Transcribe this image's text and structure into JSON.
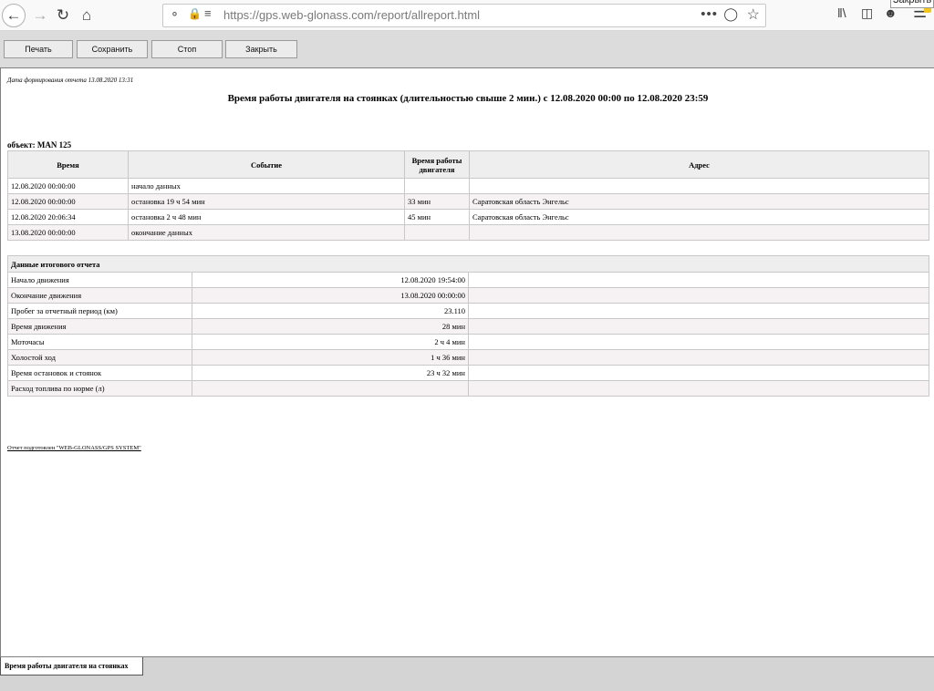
{
  "browser": {
    "url": "https://gps.web-glonass.com/report/allreport.html",
    "tooltip": "Закрыть"
  },
  "toolbar": {
    "print_label": "Печать",
    "save_label": "Сохранить",
    "stop_label": "Стоп",
    "close_label": "Закрыть"
  },
  "report": {
    "generated": "Дата формирования отчета 13.08.2020 13:31",
    "title": "Время работы двигателя на стоянках (длительностью свыше 2 мин.) с 12.08.2020 00:00 по 12.08.2020 23:59",
    "object": "объект: MAN 125",
    "columns": {
      "time": "Время",
      "event": "Событие",
      "engine": "Время работы двигателя",
      "address": "Адрес"
    },
    "rows": [
      {
        "time": "12.08.2020 00:00:00",
        "event": "начало данных",
        "engine": "",
        "address": ""
      },
      {
        "time": "12.08.2020 00:00:00",
        "event": "остановка 19 ч 54 мин",
        "engine": "33 мин",
        "address": "Саратовская область Энгельс"
      },
      {
        "time": "12.08.2020 20:06:34",
        "event": "остановка 2 ч 48 мин",
        "engine": "45 мин",
        "address": "Саратовская область Энгельс"
      },
      {
        "time": "13.08.2020 00:00:00",
        "event": "окончание данных",
        "engine": "",
        "address": ""
      }
    ],
    "summary_title": "Данные итогового отчета",
    "summary": [
      {
        "label": "Начало движения",
        "value": "12.08.2020 19:54:00"
      },
      {
        "label": "Окончание движения",
        "value": "13.08.2020 00:00:00"
      },
      {
        "label": "Пробег за отчетный период (км)",
        "value": "23.110"
      },
      {
        "label": "Время движения",
        "value": "28 мин"
      },
      {
        "label": "Моточасы",
        "value": "2 ч 4 мин"
      },
      {
        "label": "Холостой ход",
        "value": "1 ч 36 мин"
      },
      {
        "label": "Время остановок и стоянок",
        "value": "23 ч 32 мин"
      },
      {
        "label": "Расход топлива по норме (л)",
        "value": ""
      }
    ],
    "footer": "Отчет подготовлен \"WEB-GLONASS/GPS SYSTEM\""
  },
  "status_tab": "Время работы двигателя на стоянках"
}
